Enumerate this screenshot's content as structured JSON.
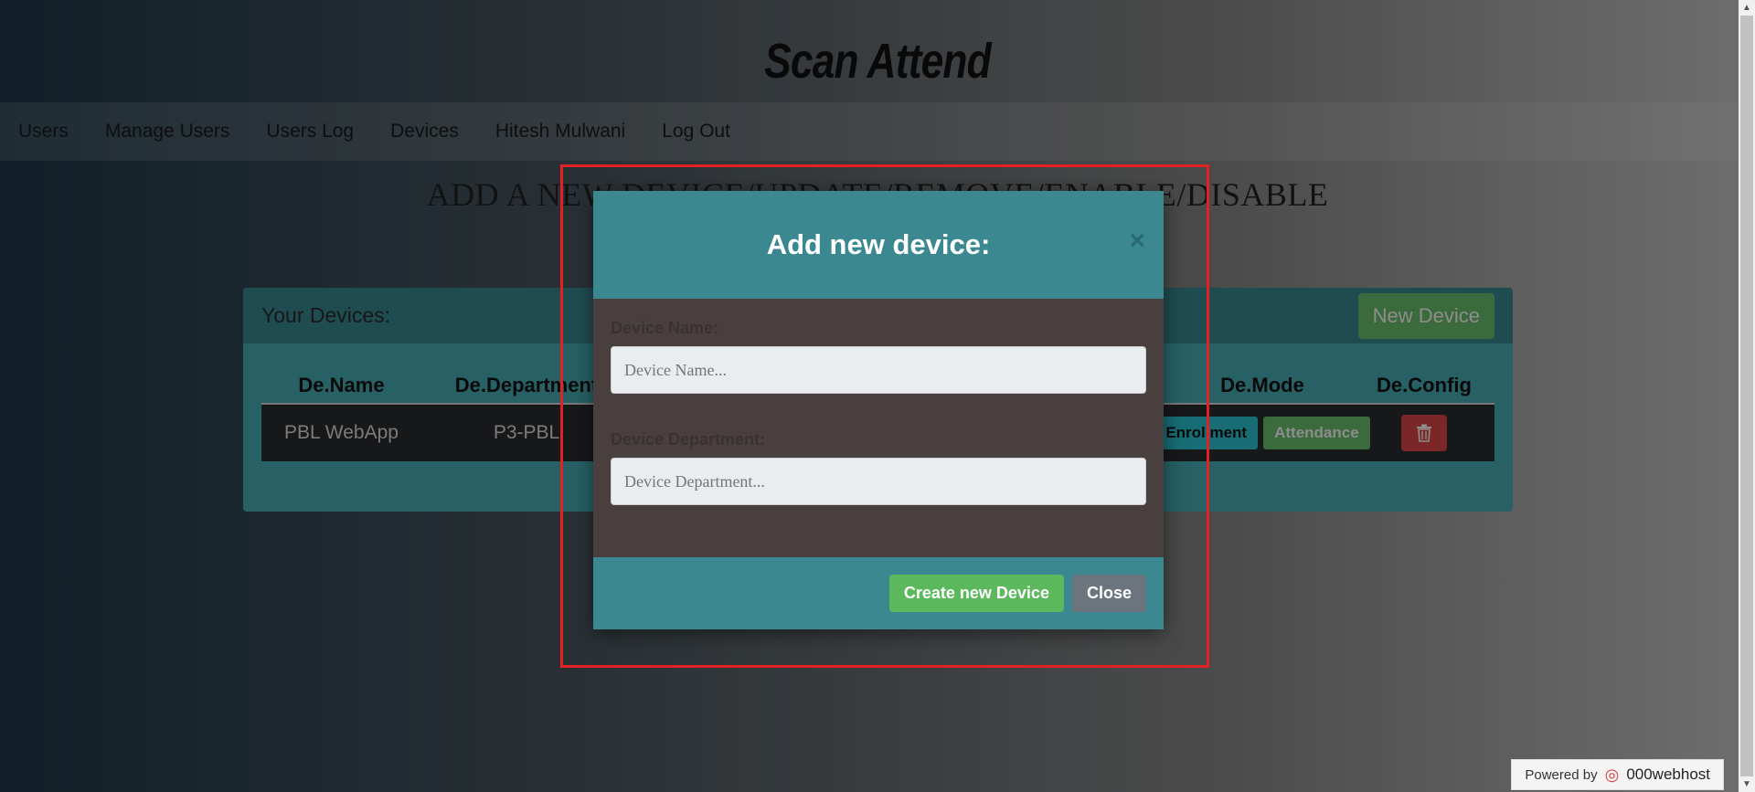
{
  "logo": "Scan Attend",
  "nav": [
    "Users",
    "Manage Users",
    "Users Log",
    "Devices",
    "Hitesh Mulwani",
    "Log Out"
  ],
  "page_heading": "ADD A NEW DEVICE/UPDATE/REMOVE/ENABLE/DISABLE",
  "panel": {
    "title": "Your Devices:",
    "new_device_label": "New Device",
    "columns": [
      "De.Name",
      "De.Department",
      "",
      "De.Mode",
      "De.Config"
    ],
    "rows": [
      {
        "name": "PBL WebApp",
        "department": "P3-PBL",
        "mode_enrollment": "Enrollment",
        "mode_attendance": "Attendance"
      }
    ]
  },
  "modal": {
    "title": "Add new device:",
    "close_icon": "×",
    "fields": [
      {
        "label": "Device Name:",
        "placeholder": "Device Name..."
      },
      {
        "label": "Device Department:",
        "placeholder": "Device Department..."
      }
    ],
    "create_label": "Create new Device",
    "close_label": "Close"
  },
  "footer_badge": {
    "powered": "Powered by",
    "host": "000webhost"
  }
}
